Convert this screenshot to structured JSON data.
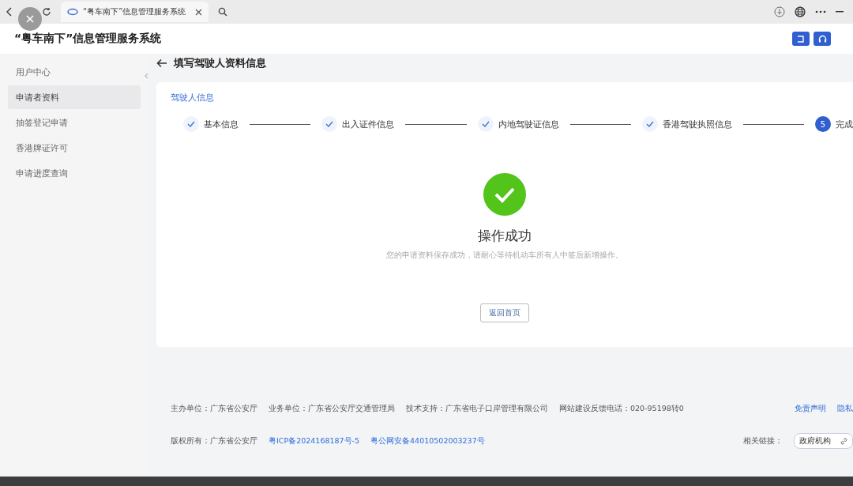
{
  "browser": {
    "tab_title": "“粤车南下”信息管理服务系统"
  },
  "header": {
    "title": "“粤车南下”信息管理服务系统"
  },
  "sidebar": {
    "items": [
      {
        "label": "用户中心",
        "selected": false
      },
      {
        "label": "申请者资料",
        "selected": true
      },
      {
        "label": "抽签登记申请",
        "selected": false
      },
      {
        "label": "香港牌证许可",
        "selected": false
      },
      {
        "label": "申请进度查询",
        "selected": false
      }
    ]
  },
  "page_title": "填写驾驶人资料信息",
  "section_title": "驾驶人信息",
  "steps": [
    {
      "label": "基本信息",
      "done": true
    },
    {
      "label": "出入证件信息",
      "done": true
    },
    {
      "label": "内地驾驶证信息",
      "done": true
    },
    {
      "label": "香港驾驶执照信息",
      "done": true
    },
    {
      "label": "完成",
      "done": false,
      "number": "5"
    }
  ],
  "result": {
    "title": "操作成功",
    "message": "您的申请资料保存成功，请耐心等待机动车所有人中签后新增操作。",
    "button": "返回首页"
  },
  "footer": {
    "row1": [
      "主办单位：广东省公安厅",
      "业务单位：广东省公安厅交通管理局",
      "技术支持：广东省电子口岸管理有限公司",
      "网站建设反馈电话：020-95198转0"
    ],
    "row1_links": [
      "免责声明",
      "隐私"
    ],
    "row2": [
      {
        "text": "版权所有：广东省公安厅",
        "kind": "text"
      },
      {
        "text": "粤ICP备2024168187号-5",
        "kind": "link"
      },
      {
        "text": "粤公网安备44010502003237号",
        "kind": "link"
      }
    ],
    "related_label": "相关链接：",
    "related_select": "政府机构"
  }
}
